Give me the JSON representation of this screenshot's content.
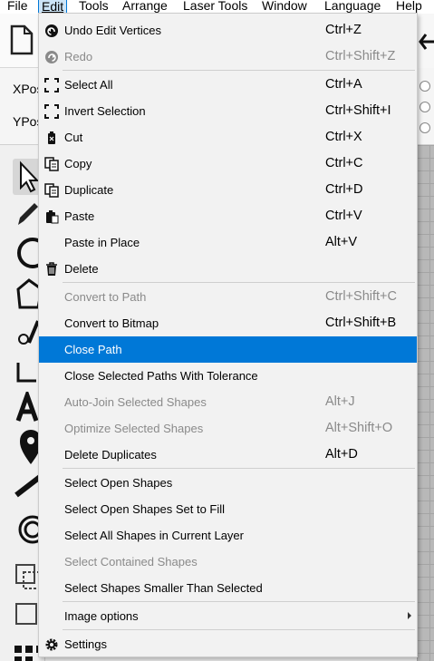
{
  "menubar": {
    "items": [
      {
        "label": "File"
      },
      {
        "label": "Edit"
      },
      {
        "label": "Tools"
      },
      {
        "label": "Arrange"
      },
      {
        "label": "Laser Tools"
      },
      {
        "label": "Window"
      },
      {
        "label": "Language"
      },
      {
        "label": "Help"
      }
    ],
    "active": "Edit"
  },
  "props": {
    "xpos_label": "XPos",
    "ypos_label": "YPos"
  },
  "colors": {
    "highlight": "#0078d7",
    "menu_bg": "#f2f2f2",
    "disabled_text": "#8a8a8a"
  },
  "edit_menu": {
    "items": [
      {
        "label": "Undo Edit Vertices",
        "shortcut": "Ctrl+Z",
        "icon": "undo-icon",
        "enabled": true
      },
      {
        "label": "Redo",
        "shortcut": "Ctrl+Shift+Z",
        "icon": "redo-icon",
        "enabled": false
      },
      {
        "label": "Select All",
        "shortcut": "Ctrl+A",
        "icon": "select-all-icon",
        "enabled": true
      },
      {
        "label": "Invert Selection",
        "shortcut": "Ctrl+Shift+I",
        "icon": "invert-selection-icon",
        "enabled": true
      },
      {
        "label": "Cut",
        "shortcut": "Ctrl+X",
        "icon": "cut-icon",
        "enabled": true
      },
      {
        "label": "Copy",
        "shortcut": "Ctrl+C",
        "icon": "copy-icon",
        "enabled": true
      },
      {
        "label": "Duplicate",
        "shortcut": "Ctrl+D",
        "icon": "duplicate-icon",
        "enabled": true
      },
      {
        "label": "Paste",
        "shortcut": "Ctrl+V",
        "icon": "paste-icon",
        "enabled": true
      },
      {
        "label": "Paste in Place",
        "shortcut": "Alt+V",
        "icon": "",
        "enabled": true
      },
      {
        "label": "Delete",
        "shortcut": "",
        "icon": "trash-icon",
        "enabled": true
      },
      {
        "label": "Convert to Path",
        "shortcut": "Ctrl+Shift+C",
        "icon": "",
        "enabled": false
      },
      {
        "label": "Convert to Bitmap",
        "shortcut": "Ctrl+Shift+B",
        "icon": "",
        "enabled": true
      },
      {
        "label": "Close Path",
        "shortcut": "",
        "icon": "",
        "enabled": true,
        "highlighted": true
      },
      {
        "label": "Close Selected Paths With Tolerance",
        "shortcut": "",
        "icon": "",
        "enabled": true
      },
      {
        "label": "Auto-Join Selected Shapes",
        "shortcut": "Alt+J",
        "icon": "",
        "enabled": false
      },
      {
        "label": "Optimize Selected Shapes",
        "shortcut": "Alt+Shift+O",
        "icon": "",
        "enabled": false
      },
      {
        "label": "Delete Duplicates",
        "shortcut": "Alt+D",
        "icon": "",
        "enabled": true
      },
      {
        "label": "Select Open Shapes",
        "shortcut": "",
        "icon": "",
        "enabled": true
      },
      {
        "label": "Select Open Shapes Set to Fill",
        "shortcut": "",
        "icon": "",
        "enabled": true
      },
      {
        "label": "Select All Shapes in Current Layer",
        "shortcut": "",
        "icon": "",
        "enabled": true
      },
      {
        "label": "Select Contained Shapes",
        "shortcut": "",
        "icon": "",
        "enabled": false
      },
      {
        "label": "Select Shapes Smaller Than Selected",
        "shortcut": "",
        "icon": "",
        "enabled": true
      },
      {
        "label": "Image options",
        "shortcut": "",
        "icon": "",
        "enabled": true,
        "submenu": true
      },
      {
        "label": "Settings",
        "shortcut": "",
        "icon": "gear-icon",
        "enabled": true
      }
    ]
  }
}
